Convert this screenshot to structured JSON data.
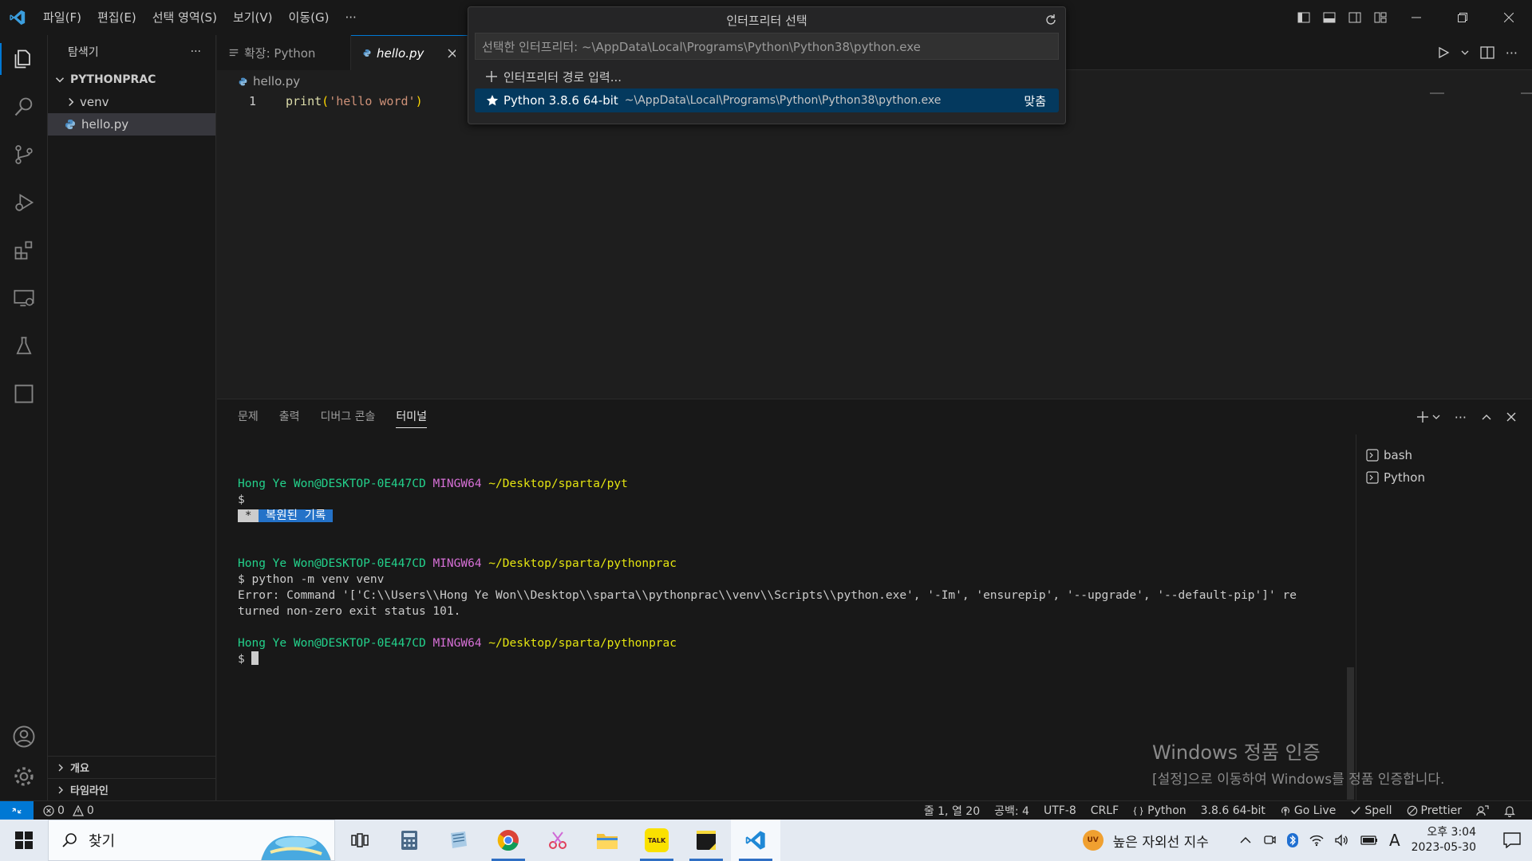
{
  "menu": [
    "파일(F)",
    "편집(E)",
    "선택 영역(S)",
    "보기(V)",
    "이동(G)",
    "···"
  ],
  "quick_pick": {
    "title": "인터프리터 선택",
    "placeholder": "선택한 인터프리터: ~\\AppData\\Local\\Programs\\Python\\Python38\\python.exe",
    "enter_path": "인터프리터 경로 입력...",
    "item_name": "Python 3.8.6 64-bit",
    "item_path": "~\\AppData\\Local\\Programs\\Python\\Python38\\python.exe",
    "item_badge": "맞춤"
  },
  "sidebar": {
    "title": "탐색기",
    "more": "···",
    "root": "PYTHONPRAC",
    "items": [
      {
        "label": "venv",
        "type": "folder"
      },
      {
        "label": "hello.py",
        "type": "file"
      }
    ],
    "outline": "개요",
    "timeline": "타임라인"
  },
  "tabs": [
    {
      "label": "확장: Python"
    },
    {
      "label": "hello.py"
    }
  ],
  "breadcrumb": "hello.py",
  "editor": {
    "line_number": "1",
    "fn": "print",
    "open": "(",
    "str": "'hello word'",
    "close": ")"
  },
  "panel": {
    "tabs": [
      "문제",
      "출력",
      "디버그 콘솔",
      "터미널"
    ],
    "active_tab": 3,
    "terminal": {
      "user": "Hong Ye Won@DESKTOP-0E447CD",
      "env": "MINGW64",
      "path1": "~/Desktop/sparta/pyt",
      "prompt": "$",
      "restored": " * ",
      "restored_label": " 복원된 기록 ",
      "path2": "~/Desktop/sparta/pythonprac",
      "cmd": "$ python -m venv venv",
      "error1": "Error: Command '['C:\\\\Users\\\\Hong Ye Won\\\\Desktop\\\\sparta\\\\pythonprac\\\\venv\\\\Scripts\\\\python.exe', '-Im', 'ensurepip', '--upgrade', '--default-pip']' re",
      "error2": "turned non-zero exit status 101.",
      "path3": "~/Desktop/sparta/pythonprac",
      "prompt2": "$ "
    },
    "terminals": [
      "bash",
      "Python"
    ]
  },
  "watermark": {
    "title": "Windows 정품 인증",
    "subtitle": "[설정]으로 이동하여 Windows를 정품 인증합니다."
  },
  "status": {
    "errors": "0",
    "warnings": "0",
    "position": "줄 1, 열 20",
    "spaces": "공백: 4",
    "encoding": "UTF-8",
    "eol": "CRLF",
    "language": "Python",
    "interpreter": "3.8.6 64-bit",
    "golive": "Go Live",
    "spell": "Spell",
    "prettier": "Prettier"
  },
  "taskbar": {
    "search": "찾기",
    "uv_badge": "UV",
    "uv_text": "높은 자외선 지수",
    "time": "오후 3:04",
    "date": "2023-05-30",
    "ime": "A",
    "kakao": "TALK"
  },
  "colors": {
    "accent": "#0078d4",
    "term_user": "#23d18b",
    "term_env": "#d670d6",
    "term_path": "#e5e510",
    "string": "#ce9178",
    "function": "#dcdcaa"
  }
}
